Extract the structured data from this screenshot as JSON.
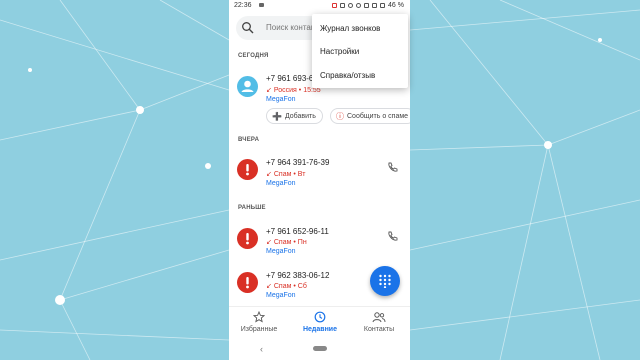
{
  "status": {
    "time": "22:36",
    "battery": "46 %"
  },
  "search": {
    "placeholder": "Поиск контактов"
  },
  "sections": {
    "today": "СЕГОДНЯ",
    "yesterday": "ВЧЕРА",
    "earlier": "РАНЬШЕ"
  },
  "calls": [
    {
      "number": "+7 961 693-6",
      "meta_country": "Россия",
      "meta_time": "15:55",
      "carrier": "MegaFon",
      "avatar": "person-avatar"
    },
    {
      "number": "+7 964 391-76-39",
      "meta_country": "Спам",
      "meta_time": "Вт",
      "carrier": "MegaFon",
      "avatar": "spam-avatar"
    },
    {
      "number": "+7 961 652-96-11",
      "meta_country": "Спам",
      "meta_time": "Пн",
      "carrier": "MegaFon",
      "avatar": "spam-avatar"
    },
    {
      "number": "+7 962 383-06-12",
      "meta_country": "Спам",
      "meta_time": "Сб",
      "carrier": "MegaFon",
      "avatar": "spam-avatar"
    }
  ],
  "chips": {
    "add": "Добавить",
    "report": "Сообщить о спаме"
  },
  "menu": {
    "items": [
      "Журнал звонков",
      "Настройки",
      "Справка/отзыв"
    ]
  },
  "nav": {
    "favorites": "Избранные",
    "recent": "Недавние",
    "contacts": "Контакты"
  },
  "colors": {
    "accent": "#1a73e8",
    "spam": "#d93025",
    "contact_avatar": "#52bde6",
    "background": "#8fcfe0"
  }
}
